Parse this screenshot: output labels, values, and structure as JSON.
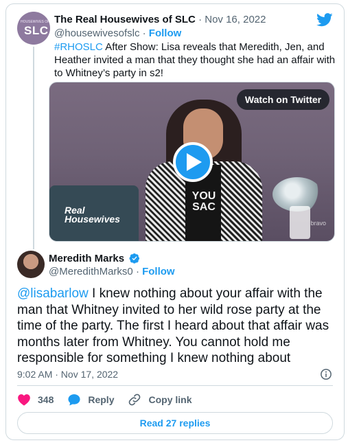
{
  "quoted_tweet": {
    "avatar_text": "SLC",
    "avatar_small_text": "HOUSEWIVES OF",
    "name": "The Real Housewives of SLC",
    "separator": "·",
    "date": "Nov 16, 2022",
    "handle": "@housewivesofslc",
    "follow_label": "Follow",
    "hashtag": "#RHOSLC",
    "text": " After Show: Lisa reveals that Meredith, Jen, and Heather invited a man that they thought she had an affair with to Whitney’s party in s2!",
    "media": {
      "watch_label": "Watch on Twitter",
      "shirt_text": "YOU\nSAC",
      "logo_text": "Real\nHousewives",
      "watermark": "bravo"
    }
  },
  "main_tweet": {
    "name": "Meredith Marks",
    "handle": "@MeredithMarks0",
    "separator": "·",
    "follow_label": "Follow",
    "mention": "@lisabarlow",
    "text": " I knew nothing about your affair with the man that Whitney invited to her wild rose party at the time of the party.  The first I heard about that affair was months later from Whitney. You cannot hold me responsible for something I knew nothing about",
    "timestamp": "9:02 AM · Nov 17, 2022",
    "likes": "348",
    "reply_label": "Reply",
    "copy_link_label": "Copy link",
    "read_replies_label": "Read 27 replies"
  },
  "colors": {
    "accent": "#1d9bf0",
    "like": "#f91880",
    "muted": "#536471",
    "border": "#cfd9de"
  }
}
